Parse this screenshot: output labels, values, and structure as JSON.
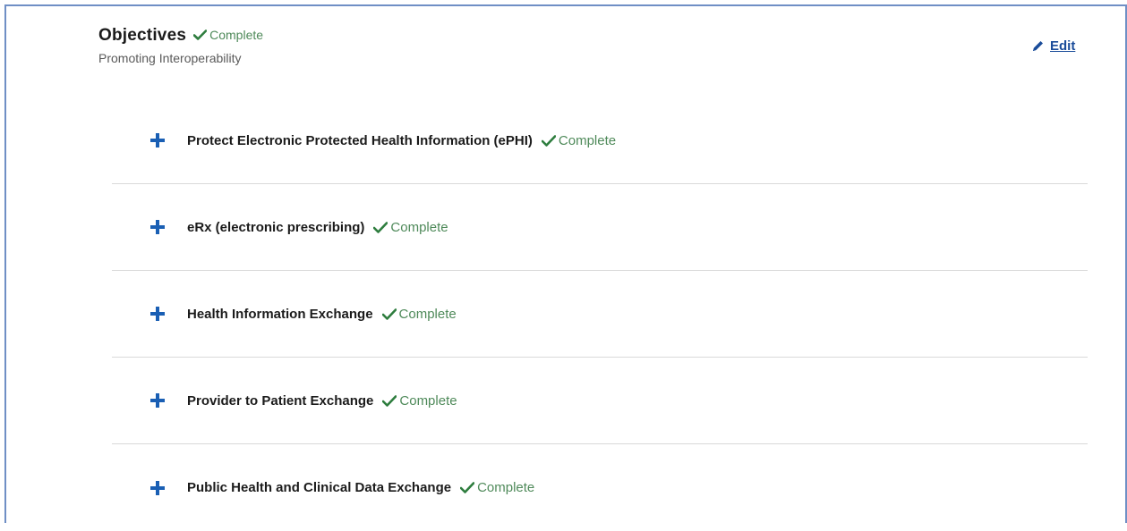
{
  "section": {
    "title": "Objectives",
    "status": "Complete",
    "subtitle": "Promoting Interoperability",
    "edit_label": "Edit"
  },
  "items": [
    {
      "label": "Protect Electronic Protected Health Information (ePHI)",
      "status": "Complete"
    },
    {
      "label": "eRx (electronic prescribing)",
      "status": "Complete"
    },
    {
      "label": "Health Information Exchange",
      "status": "Complete"
    },
    {
      "label": "Provider to Patient Exchange",
      "status": "Complete"
    },
    {
      "label": "Public Health and Clinical Data Exchange",
      "status": "Complete"
    }
  ],
  "colors": {
    "accent": "#1a5fb4",
    "link": "#1a4c9a",
    "success": "#4f8a5a",
    "frame_border": "#6f8fc5"
  },
  "icons": {
    "expand": "plus-icon",
    "status": "check-icon",
    "edit": "pencil-icon"
  }
}
